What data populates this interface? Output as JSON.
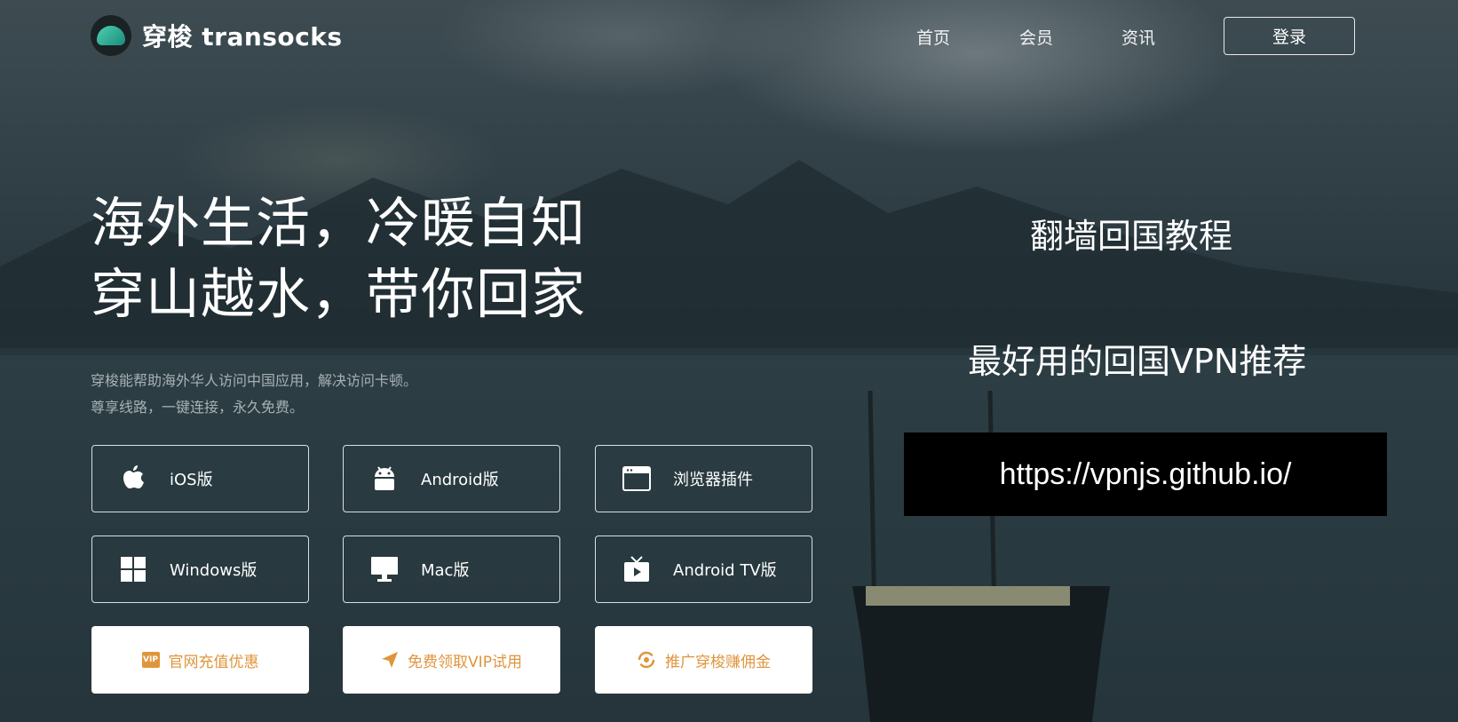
{
  "header": {
    "brand": "穿梭 transocks",
    "nav": [
      "首页",
      "会员",
      "资讯"
    ],
    "login_label": "登录"
  },
  "hero": {
    "title_line1": "海外生活，冷暖自知",
    "title_line2": "穿山越水，带你回家",
    "subtitle_line1": "穿梭能帮助海外华人访问中国应用，解决访问卡顿。",
    "subtitle_line2": "尊享线路，一键连接，永久免费。"
  },
  "downloads": [
    {
      "label": "iOS版",
      "icon": "apple-icon"
    },
    {
      "label": "Android版",
      "icon": "android-icon"
    },
    {
      "label": "浏览器插件",
      "icon": "browser-icon"
    },
    {
      "label": "Windows版",
      "icon": "windows-icon"
    },
    {
      "label": "Mac版",
      "icon": "monitor-icon"
    },
    {
      "label": "Android TV版",
      "icon": "tv-icon"
    }
  ],
  "promos": [
    {
      "label": "官网充值优惠",
      "icon": "vip-icon"
    },
    {
      "label": "免费领取VIP试用",
      "icon": "send-icon"
    },
    {
      "label": "推广穿梭赚佣金",
      "icon": "refresh-icon"
    }
  ],
  "overlay": {
    "title1": "翻墙回国教程",
    "title2": "最好用的回国VPN推荐",
    "url": "https://vpnjs.github.io/"
  },
  "colors": {
    "accent_orange": "#e0953d",
    "url_box_bg": "#000000"
  }
}
